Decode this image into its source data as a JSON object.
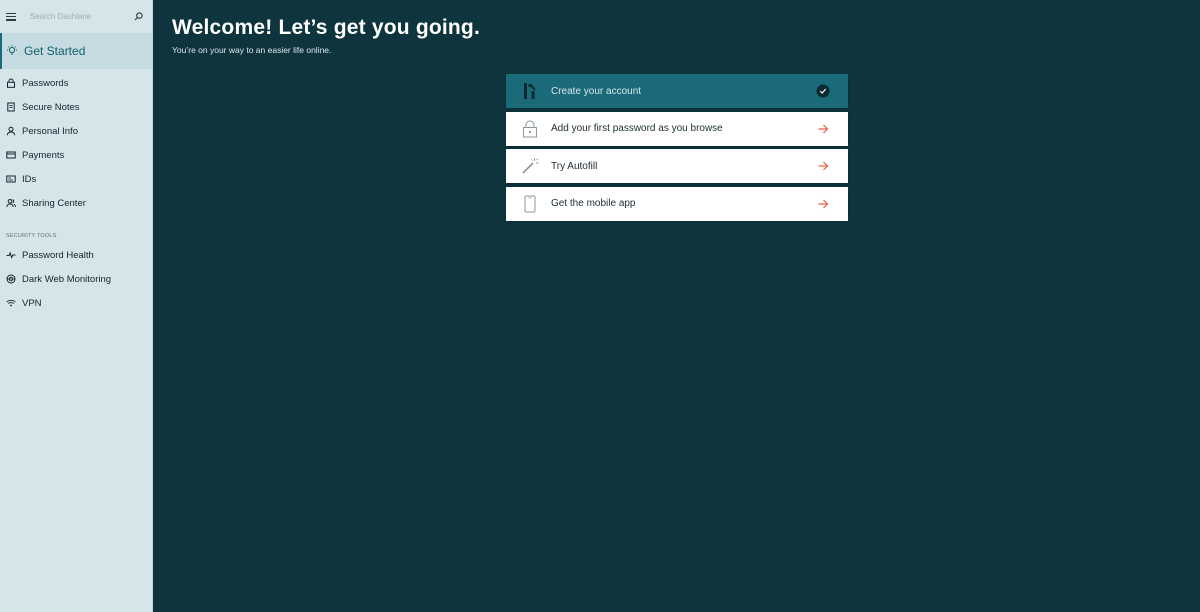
{
  "sidebar": {
    "search_placeholder": "Search Dashlane",
    "active_item": {
      "label": "Get Started",
      "icon": "lightbulb-icon"
    },
    "items": [
      {
        "label": "Passwords",
        "icon": "lock-icon"
      },
      {
        "label": "Secure Notes",
        "icon": "note-icon"
      },
      {
        "label": "Personal Info",
        "icon": "person-icon"
      },
      {
        "label": "Payments",
        "icon": "card-icon"
      },
      {
        "label": "IDs",
        "icon": "id-card-icon"
      },
      {
        "label": "Sharing Center",
        "icon": "people-icon"
      }
    ],
    "section_label": "SECURITY TOOLS",
    "tools": [
      {
        "label": "Password Health",
        "icon": "pulse-icon"
      },
      {
        "label": "Dark Web Monitoring",
        "icon": "radar-icon"
      },
      {
        "label": "VPN",
        "icon": "wifi-icon"
      }
    ]
  },
  "main": {
    "title": "Welcome! Let’s get you going.",
    "subtitle": "You’re on your way to an easier life online.",
    "steps": [
      {
        "label": "Create your account",
        "icon": "dashlane-logo-icon",
        "status": "completed"
      },
      {
        "label": "Add your first password as you browse",
        "icon": "lock-icon",
        "status": "pending"
      },
      {
        "label": "Try Autofill",
        "icon": "magic-wand-icon",
        "status": "pending"
      },
      {
        "label": "Get the mobile app",
        "icon": "phone-icon",
        "status": "pending"
      }
    ]
  },
  "colors": {
    "background": "#0e353d",
    "sidebar": "#d6e5ea",
    "accent": "#1b6a79",
    "arrow": "#f05a41"
  }
}
